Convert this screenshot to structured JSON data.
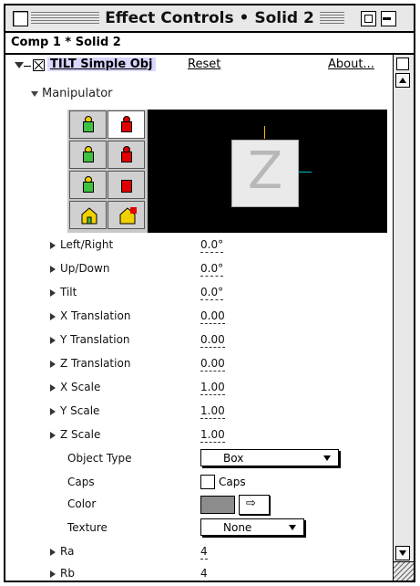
{
  "window": {
    "title": "Effect Controls • Solid 2",
    "breadcrumb": "Comp 1 * Solid 2"
  },
  "effect": {
    "name": "TILT Simple Obj",
    "reset_label": "Reset",
    "about_label": "About..."
  },
  "manipulator": {
    "label": "Manipulator",
    "preview_glyph": "Z",
    "tools": [
      {
        "icon": "rotate-xy-icon",
        "active": false
      },
      {
        "icon": "rotate-xy-red-icon",
        "active": true
      },
      {
        "icon": "translate-xy-icon",
        "active": false
      },
      {
        "icon": "translate-xy-red-icon",
        "active": false
      },
      {
        "icon": "translate-z-icon",
        "active": false
      },
      {
        "icon": "scale-red-icon",
        "active": false
      },
      {
        "icon": "home-icon",
        "active": false
      },
      {
        "icon": "home-red-icon",
        "active": false
      }
    ]
  },
  "properties": [
    {
      "label": "Left/Right",
      "value": "0.0°"
    },
    {
      "label": "Up/Down",
      "value": "0.0°"
    },
    {
      "label": "Tilt",
      "value": "0.0°"
    },
    {
      "label": "X Translation",
      "value": "0.00"
    },
    {
      "label": "Y Translation",
      "value": "0.00"
    },
    {
      "label": "Z Translation",
      "value": "0.00"
    },
    {
      "label": "X Scale",
      "value": "1.00"
    },
    {
      "label": "Y Scale",
      "value": "1.00"
    },
    {
      "label": "Z Scale",
      "value": "1.00"
    }
  ],
  "object_type": {
    "label": "Object Type",
    "value": "Box"
  },
  "caps": {
    "label": "Caps",
    "checkbox_label": "Caps"
  },
  "color": {
    "label": "Color",
    "swatch": "#8c8c8c"
  },
  "texture": {
    "label": "Texture",
    "value": "None"
  },
  "extra_properties": [
    {
      "label": "Ra",
      "value": "4"
    },
    {
      "label": "Rb",
      "value": "4"
    }
  ]
}
